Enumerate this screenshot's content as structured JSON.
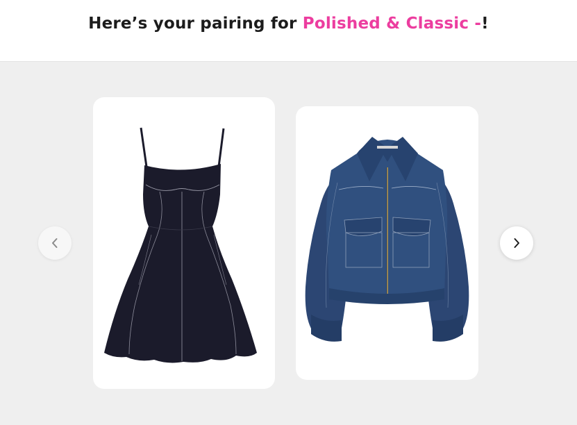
{
  "header": {
    "title_prefix": "Here’s your pairing for ",
    "title_highlight": "Polished & Classic -",
    "title_suffix": "!",
    "accent_color": "#ec3d9f"
  },
  "carousel": {
    "prev_icon": "chevron-left-icon",
    "next_icon": "chevron-right-icon",
    "items": [
      {
        "item": "black-corset-mini-dress",
        "icon": "dress-image"
      },
      {
        "item": "denim-zip-jacket",
        "icon": "jacket-image"
      }
    ]
  },
  "colors": {
    "background": "#efefef",
    "dress": "#1b1b2b",
    "denim": "#2f4a78"
  }
}
